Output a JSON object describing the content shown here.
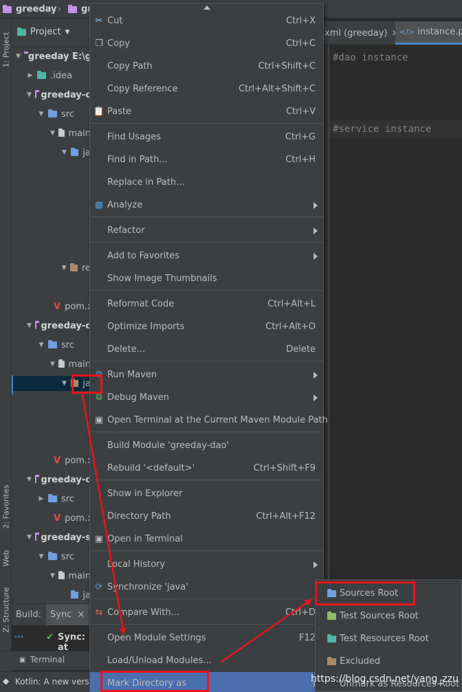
{
  "navbar": {
    "project": "greeday",
    "sep": "›",
    "module": "gr"
  },
  "left_strip": {
    "project_tab": "1: Project",
    "favorites_tab": "2: Favorites",
    "web_tab": "Web",
    "structure_tab": "Z: Structure"
  },
  "project_panel": {
    "title": "Project",
    "rows": [
      {
        "text": "greeday  E:\\g",
        "arrow": "▼",
        "icon": "purple"
      },
      {
        "text": ".idea",
        "arrow": "▶",
        "icon": "teal"
      },
      {
        "text": "greeday-c",
        "arrow": "▼",
        "icon": "purple"
      },
      {
        "text": "src",
        "arrow": "▼",
        "icon": "blue"
      },
      {
        "text": "main",
        "arrow": "▼",
        "icon": "white"
      },
      {
        "text": "ja",
        "arrow": "▼",
        "icon": "blue"
      },
      {
        "text": "re",
        "arrow": "▼",
        "icon": "brown"
      },
      {
        "text": "pom.xm",
        "arrow": "",
        "icon": "maven"
      },
      {
        "text": "greeday-c",
        "arrow": "▼",
        "icon": "purple"
      },
      {
        "text": "src",
        "arrow": "▼",
        "icon": "blue"
      },
      {
        "text": "main",
        "arrow": "▼",
        "icon": "white"
      },
      {
        "text": "ja",
        "arrow": "▼",
        "icon": "brown"
      },
      {
        "text": "pom.xm",
        "arrow": "",
        "icon": "maven"
      },
      {
        "text": "greeday-c",
        "arrow": "▼",
        "icon": "purple"
      },
      {
        "text": "src",
        "arrow": "▶",
        "icon": "blue"
      },
      {
        "text": "pom.xm",
        "arrow": "",
        "icon": "maven"
      },
      {
        "text": "greeday-s",
        "arrow": "▼",
        "icon": "purple"
      },
      {
        "text": "src",
        "arrow": "▼",
        "icon": "blue"
      },
      {
        "text": "main",
        "arrow": "▼",
        "icon": "white"
      },
      {
        "text": "ja",
        "arrow": "",
        "icon": "blue"
      }
    ]
  },
  "editor": {
    "tabs": [
      {
        "label": "xml (greeday)",
        "close": "×"
      },
      {
        "label": "instance.pro",
        "close": ""
      }
    ],
    "lines": [
      "#dao instance",
      "#service instance"
    ]
  },
  "bottom": {
    "build": "Build:",
    "sync": "Sync",
    "sync_close": "×",
    "sync_status": "Sync: at",
    "terminal": "Terminal",
    "kotlin_msg": "Kotlin: A new versio"
  },
  "context_menu": {
    "items": [
      {
        "label": "Cut",
        "shortcut": "Ctrl+X",
        "icon": "scissors-icon",
        "glyph": "✂"
      },
      {
        "label": "Copy",
        "shortcut": "Ctrl+C",
        "icon": "copy-icon",
        "glyph": "❐"
      },
      {
        "label": "Copy Path",
        "shortcut": "Ctrl+Shift+C"
      },
      {
        "label": "Copy Reference",
        "shortcut": "Ctrl+Alt+Shift+C"
      },
      {
        "label": "Paste",
        "shortcut": "Ctrl+V",
        "icon": "paste-icon",
        "glyph": "📋"
      },
      {
        "label": "Find Usages",
        "shortcut": "Ctrl+G"
      },
      {
        "label": "Find in Path...",
        "shortcut": "Ctrl+H"
      },
      {
        "label": "Replace in Path..."
      },
      {
        "label": "Analyze",
        "submenu": true,
        "icon": "analyze-icon",
        "glyph": "▦"
      },
      {
        "label": "Refactor",
        "submenu": true
      },
      {
        "label": "Add to Favorites",
        "submenu": true
      },
      {
        "label": "Show Image Thumbnails"
      },
      {
        "label": "Reformat Code",
        "shortcut": "Ctrl+Alt+L"
      },
      {
        "label": "Optimize Imports",
        "shortcut": "Ctrl+Alt+O"
      },
      {
        "label": "Delete...",
        "shortcut": "Delete"
      },
      {
        "label": "Run Maven",
        "submenu": true,
        "icon": "gear-icon",
        "glyph": "⚙"
      },
      {
        "label": "Debug Maven",
        "submenu": true,
        "icon": "debug-gear-icon",
        "glyph": "⚙"
      },
      {
        "label": "Open Terminal at the Current Maven Module Path",
        "icon": "terminal-icon",
        "glyph": "▣"
      },
      {
        "label": "Build Module 'greeday-dao'"
      },
      {
        "label": "Rebuild '<default>'",
        "shortcut": "Ctrl+Shift+F9"
      },
      {
        "label": "Show in Explorer"
      },
      {
        "label": "Directory Path",
        "shortcut": "Ctrl+Alt+F12"
      },
      {
        "label": "Open in Terminal",
        "icon": "terminal-icon",
        "glyph": "▣"
      },
      {
        "label": "Local History",
        "submenu": true
      },
      {
        "label": "Synchronize 'java'",
        "icon": "sync-icon",
        "glyph": "⟳"
      },
      {
        "label": "Compare With...",
        "shortcut": "Ctrl+D",
        "icon": "compare-icon",
        "glyph": "⇆"
      },
      {
        "label": "Open Module Settings",
        "shortcut": "F12"
      },
      {
        "label": "Load/Unload Modules..."
      },
      {
        "label": "Mark Directory as",
        "submenu": true
      }
    ]
  },
  "submenu": {
    "items": [
      {
        "label": "Sources Root",
        "icon": "blue"
      },
      {
        "label": "Test Sources Root",
        "icon": "green"
      },
      {
        "label": "Test Resources Root",
        "icon": "teal"
      },
      {
        "label": "Excluded",
        "icon": "brown"
      },
      {
        "label": "Unmark as Resources Root",
        "icon": ""
      }
    ]
  },
  "watermark": "https://blog.csdn.net/yang_zzu",
  "colors": {
    "accent": "#4b6eaf",
    "annotation": "#e8141c",
    "menu_bg": "#3c3f41",
    "editor_bg": "#2b2b2b"
  }
}
